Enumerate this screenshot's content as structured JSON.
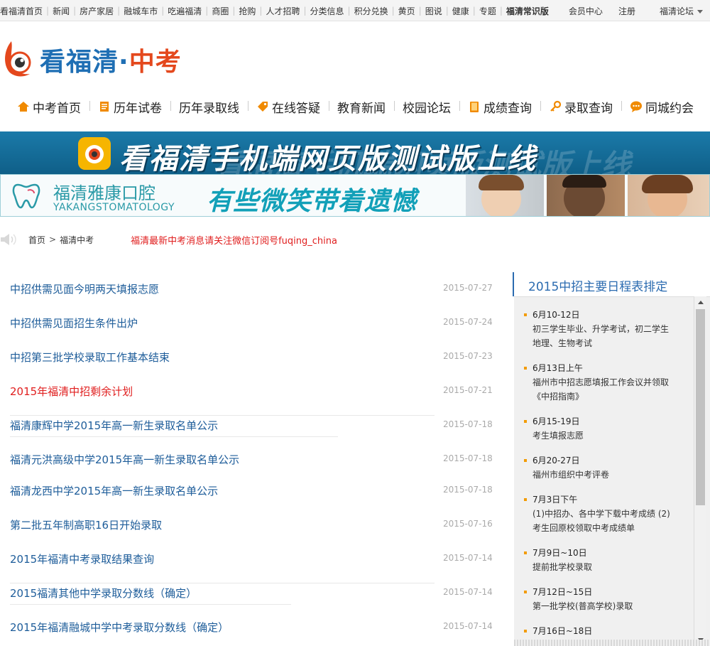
{
  "topbar": {
    "links": [
      {
        "label": "看福清首页",
        "bold": false
      },
      {
        "label": "新闻",
        "bold": false
      },
      {
        "label": "房产家居",
        "bold": false
      },
      {
        "label": "融城车市",
        "bold": false
      },
      {
        "label": "吃遍福清",
        "bold": false
      },
      {
        "label": "商圈",
        "bold": false
      },
      {
        "label": "抢购",
        "bold": false
      },
      {
        "label": "人才招聘",
        "bold": false
      },
      {
        "label": "分类信息",
        "bold": false
      },
      {
        "label": "积分兑换",
        "bold": false
      },
      {
        "label": "黄页",
        "bold": false
      },
      {
        "label": "图说",
        "bold": false
      },
      {
        "label": "健康",
        "bold": false
      },
      {
        "label": "专题",
        "bold": false
      },
      {
        "label": "福清常识版",
        "bold": true
      }
    ],
    "member": "会员中心",
    "register": "注册",
    "forum": "福清论坛"
  },
  "logo": {
    "brand": "看福清",
    "dot": "·",
    "sub": "中考"
  },
  "mainnav": [
    {
      "label": "中考首页",
      "icon": "home-icon"
    },
    {
      "label": "历年试卷",
      "icon": "document-icon"
    },
    {
      "label": "历年录取线",
      "icon": ""
    },
    {
      "label": "在线答疑",
      "icon": "tag-icon"
    },
    {
      "label": "教育新闻",
      "icon": ""
    },
    {
      "label": "校园论坛",
      "icon": ""
    },
    {
      "label": "成绩查询",
      "icon": "book-icon"
    },
    {
      "label": "录取查询",
      "icon": "key-icon"
    },
    {
      "label": "同城约会",
      "icon": "chat-icon"
    }
  ],
  "banners": {
    "mobile": "看福清手机端网页版测试版上线",
    "dental_cn": "福清雅康口腔",
    "dental_en": "YAKANGSTOMATOLOGY",
    "dental_slogan": "有些微笑带着遗憾"
  },
  "breadcrumb": {
    "home": "首页",
    "arrow": ">",
    "current": "福清中考",
    "notice": "福清最新中考消息请关注微信订阅号fuqing_china"
  },
  "news": [
    {
      "title": "中招供需见面今明两天填报志愿",
      "date": "2015-07-27",
      "red": false
    },
    {
      "title": "中招供需见面招生条件出炉",
      "date": "2015-07-24",
      "red": false
    },
    {
      "title": "中招第三批学校录取工作基本结束",
      "date": "2015-07-23",
      "red": false
    },
    {
      "title": "2015年福清中招剩余计划",
      "date": "2015-07-21",
      "red": true
    },
    {
      "title": "福清康辉中学2015年高一新生录取名单公示",
      "date": "2015-07-18",
      "red": false
    },
    {
      "title": "福清元洪高级中学2015年高一新生录取名单公示",
      "date": "2015-07-18",
      "red": false
    },
    {
      "title": "福清龙西中学2015年高一新生录取名单公示",
      "date": "2015-07-18",
      "red": false
    },
    {
      "title": "第二批五年制高职16日开始录取",
      "date": "2015-07-16",
      "red": false
    },
    {
      "title": "2015年福清中考录取结果查询",
      "date": "2015-07-14",
      "red": false
    },
    {
      "title": "2015福清其他中学录取分数线（确定）",
      "date": "2015-07-14",
      "red": false
    },
    {
      "title": "2015年福清融城中学中考录取分数线（确定）",
      "date": "2015-07-14",
      "red": false
    }
  ],
  "schedule": {
    "title": "2015中招主要日程表排定",
    "items": [
      {
        "date": "6月10-12日",
        "text": "初三学生毕业、升学考试，初二学生地理、生物考试"
      },
      {
        "date": "6月13日上午",
        "text": "福州市中招志愿填报工作会议并领取《中招指南》"
      },
      {
        "date": "6月15-19日",
        "text": "考生填报志愿"
      },
      {
        "date": "6月20-27日",
        "text": "福州市组织中考评卷"
      },
      {
        "date": "7月3日下午",
        "text": "(1)中招办、各中学下载中考成绩 (2)考生回原校领取中考成绩单"
      },
      {
        "date": "7月9日~10日",
        "text": "提前批学校录取"
      },
      {
        "date": "7月12日~15日",
        "text": "第一批学校(普高学校)录取"
      },
      {
        "date": "7月16日~18日",
        "text": ""
      }
    ]
  },
  "colors": {
    "link_blue": "#1e5d9a",
    "accent_red": "#e01e1e",
    "brand_blue": "#1f6fb4",
    "brand_orange": "#e4481d"
  }
}
